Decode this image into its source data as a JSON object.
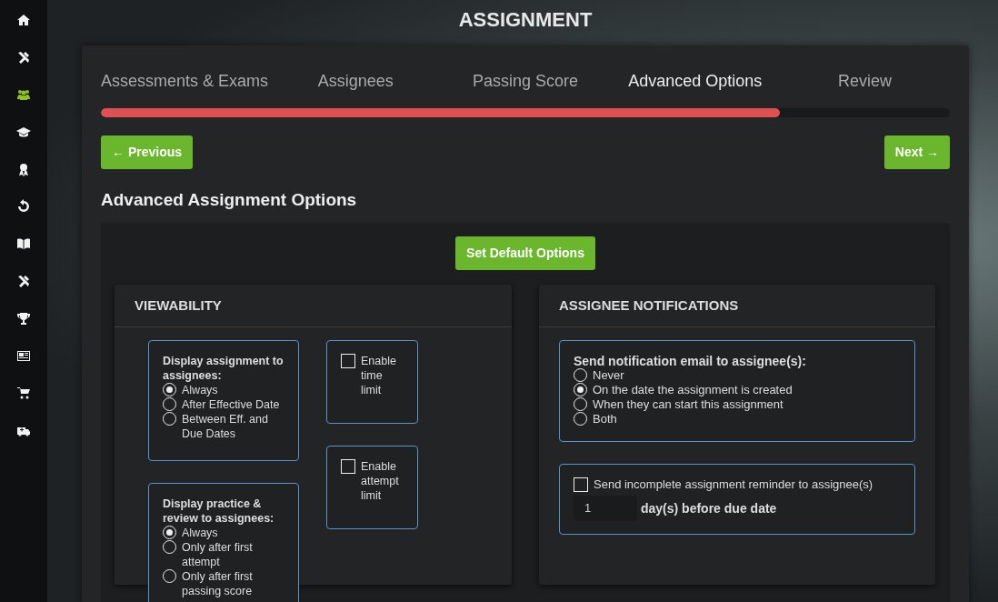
{
  "sidebar": {
    "items": [
      {
        "kind": "home",
        "selected": false
      },
      {
        "kind": "tools",
        "selected": false
      },
      {
        "kind": "users",
        "selected": true
      },
      {
        "kind": "cap",
        "selected": false
      },
      {
        "kind": "award",
        "selected": false
      },
      {
        "kind": "history",
        "selected": false
      },
      {
        "kind": "book",
        "selected": false
      },
      {
        "kind": "tools",
        "selected": false
      },
      {
        "kind": "trophy",
        "selected": false
      },
      {
        "kind": "news",
        "selected": false
      },
      {
        "kind": "cart",
        "selected": false
      },
      {
        "kind": "ambulance",
        "selected": false
      }
    ]
  },
  "page_title": "ASSIGNMENT",
  "tabs": [
    {
      "label": "Assessments & Exams",
      "selected": false
    },
    {
      "label": "Assignees",
      "selected": false
    },
    {
      "label": "Passing Score",
      "selected": false
    },
    {
      "label": "Advanced Options",
      "selected": true
    },
    {
      "label": "Review",
      "selected": false
    }
  ],
  "progress": {
    "level": 0.8
  },
  "previous_button": "← Previous",
  "next_button": "Next →",
  "section_title": "Advanced Assignment Options",
  "default_button": "Set Default Options",
  "viewability": {
    "title": "VIEWABILITY",
    "groups": [
      {
        "label": "Display assignment to assignees:",
        "options": [
          {
            "label": "Always",
            "selected": true
          },
          {
            "label": "After Effective Date",
            "selected": false
          },
          {
            "label": "Between Eff. and Due Dates",
            "selected": false
          }
        ]
      },
      {
        "label": "Display practice & review to assignees:",
        "options": [
          {
            "label": "Always",
            "selected": true
          },
          {
            "label": "Only after first attempt",
            "selected": false
          },
          {
            "label": "Only after first passing score",
            "selected": false
          }
        ]
      }
    ],
    "checkboxes": [
      {
        "label": "Enable time limit",
        "checked": false
      },
      {
        "label": "Enable attempt limit",
        "checked": false
      }
    ]
  },
  "notifications": {
    "title": "ASSIGNEE NOTIFICATIONS",
    "group": {
      "label": "Send notification email to assignee(s):",
      "options": [
        {
          "label": "Never",
          "selected": false
        },
        {
          "label": "On the date the assignment is created",
          "selected": true
        },
        {
          "label": "When they can start this assignment",
          "selected": false
        },
        {
          "label": "Both",
          "selected": false
        }
      ]
    },
    "reminder": {
      "label": "Send incomplete assignment reminder to assignee(s)",
      "checked": false,
      "days": "1",
      "days_label": "day(s) before due date"
    }
  }
}
